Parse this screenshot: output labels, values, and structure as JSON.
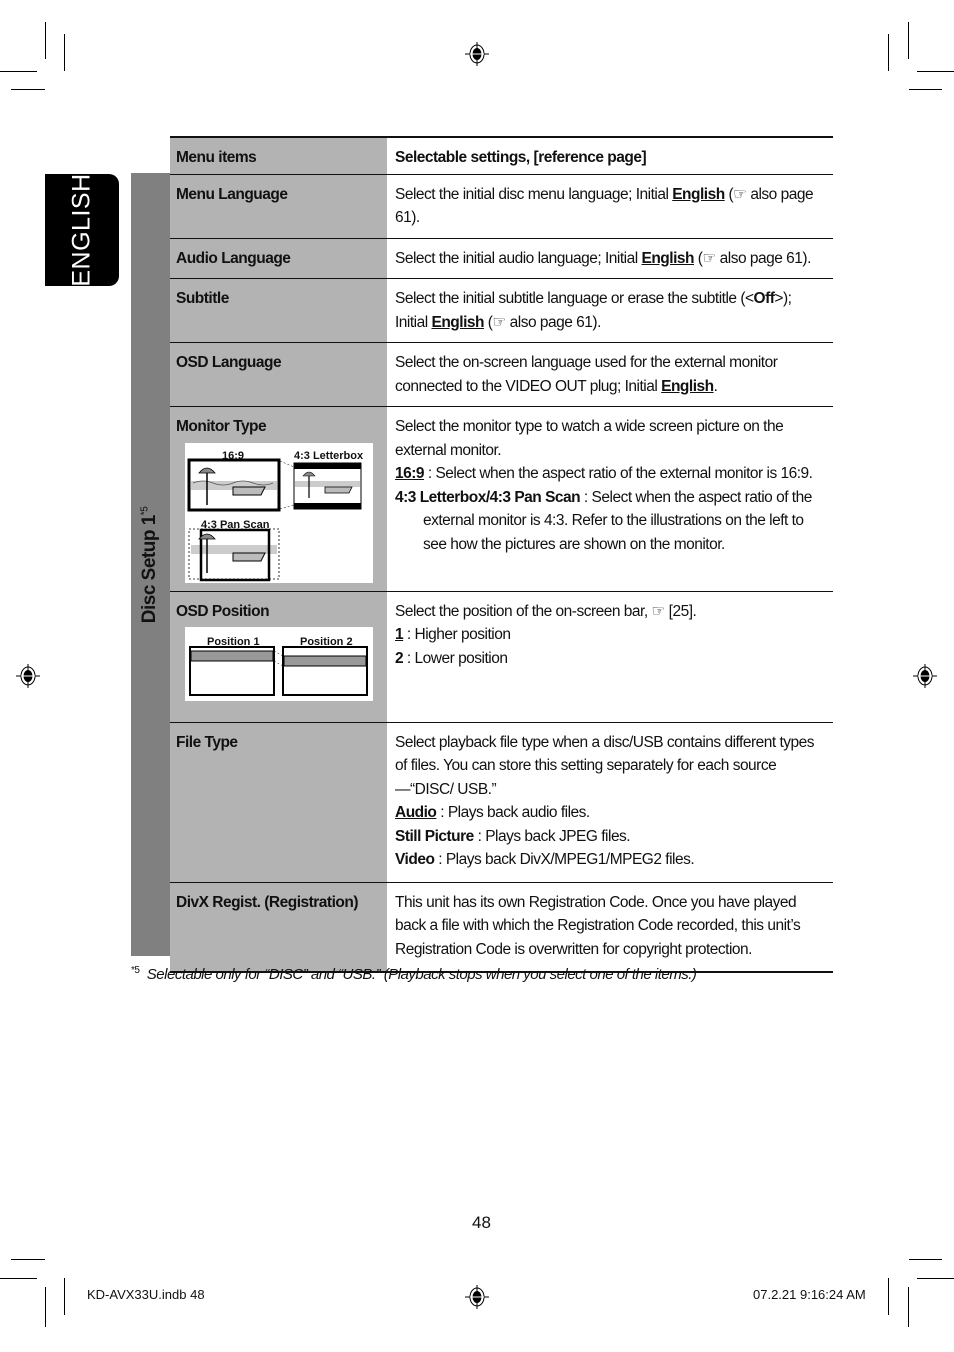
{
  "language_tab": "ENGLISH",
  "section_label": "Disc Setup 1",
  "section_note_marker": "*5",
  "table": {
    "headers": [
      "Menu items",
      "Selectable settings, [reference page]"
    ],
    "rows": [
      {
        "item": "Menu Language",
        "desc_pre": "Select the initial disc menu language; Initial ",
        "desc_bold": "English",
        "desc_post": " (☞ also page 61)."
      },
      {
        "item": "Audio Language",
        "desc_pre": "Select the initial audio language; Initial ",
        "desc_bold": "English",
        "desc_post": " (☞ also page 61)."
      },
      {
        "item": "Subtitle",
        "desc_pre": "Select the initial subtitle language or erase the subtitle (<",
        "desc_off": "Off",
        "desc_mid": ">); Initial ",
        "desc_bold": "English",
        "desc_post": " (☞ also page 61)."
      },
      {
        "item": "OSD Language",
        "desc_pre": "Select the on-screen language used for the external monitor connected to the VIDEO OUT plug; Initial ",
        "desc_bold": "English",
        "desc_post": "."
      },
      {
        "item": "Monitor Type",
        "figure_labels": [
          "16:9",
          "4:3 Letterbox",
          "4:3 Pan Scan"
        ],
        "intro": "Select the monitor type to watch a wide screen picture on the external monitor.",
        "options": [
          {
            "key": "16:9",
            "text": " : Select when the aspect ratio of the external monitor is 16:9.",
            "default": true
          },
          {
            "key": "4:3 Letterbox/4:3 Pan Scan",
            "text": " : Select when the aspect ratio of the external monitor is 4:3. Refer to the illustrations on the left to see how the pictures are shown on the monitor.",
            "default": false
          }
        ]
      },
      {
        "item": "OSD Position",
        "figure_labels": [
          "Position 1",
          "Position 2"
        ],
        "intro": "Select the position of the on-screen bar, ☞ [25].",
        "options": [
          {
            "key": "1",
            "text": " : Higher position",
            "default": true
          },
          {
            "key": "2",
            "text": " : Lower position",
            "default": false
          }
        ]
      },
      {
        "item": "File Type",
        "intro": "Select playback file type when a disc/USB contains different types of files. You can store this setting separately for each source —“DISC/ USB.”",
        "options": [
          {
            "key": "Audio",
            "text": " : Plays back audio files.",
            "default": true
          },
          {
            "key": "Still Picture",
            "text": " : Plays back JPEG files.",
            "default": false
          },
          {
            "key": "Video",
            "text": " : Plays back DivX/MPEG1/MPEG2 files.",
            "default": false
          }
        ]
      },
      {
        "item": "DivX Regist. (Registration)",
        "intro": "This unit has its own Registration Code. Once you have played back a file with which the Registration Code recorded, this unit’s Registration Code is overwritten for copyright protection."
      }
    ]
  },
  "footnote": {
    "marker": "*5",
    "text": "Selectable only for “DISC” and “USB.” (Playback stops when you select one of the items.)"
  },
  "page_number": "48",
  "slug": {
    "file": "KD-AVX33U.indb   48",
    "timestamp": "07.2.21   9:16:24 AM"
  },
  "icons": {
    "registration_mark": "crosshair-target",
    "reference": "pointing-hand ☞"
  }
}
